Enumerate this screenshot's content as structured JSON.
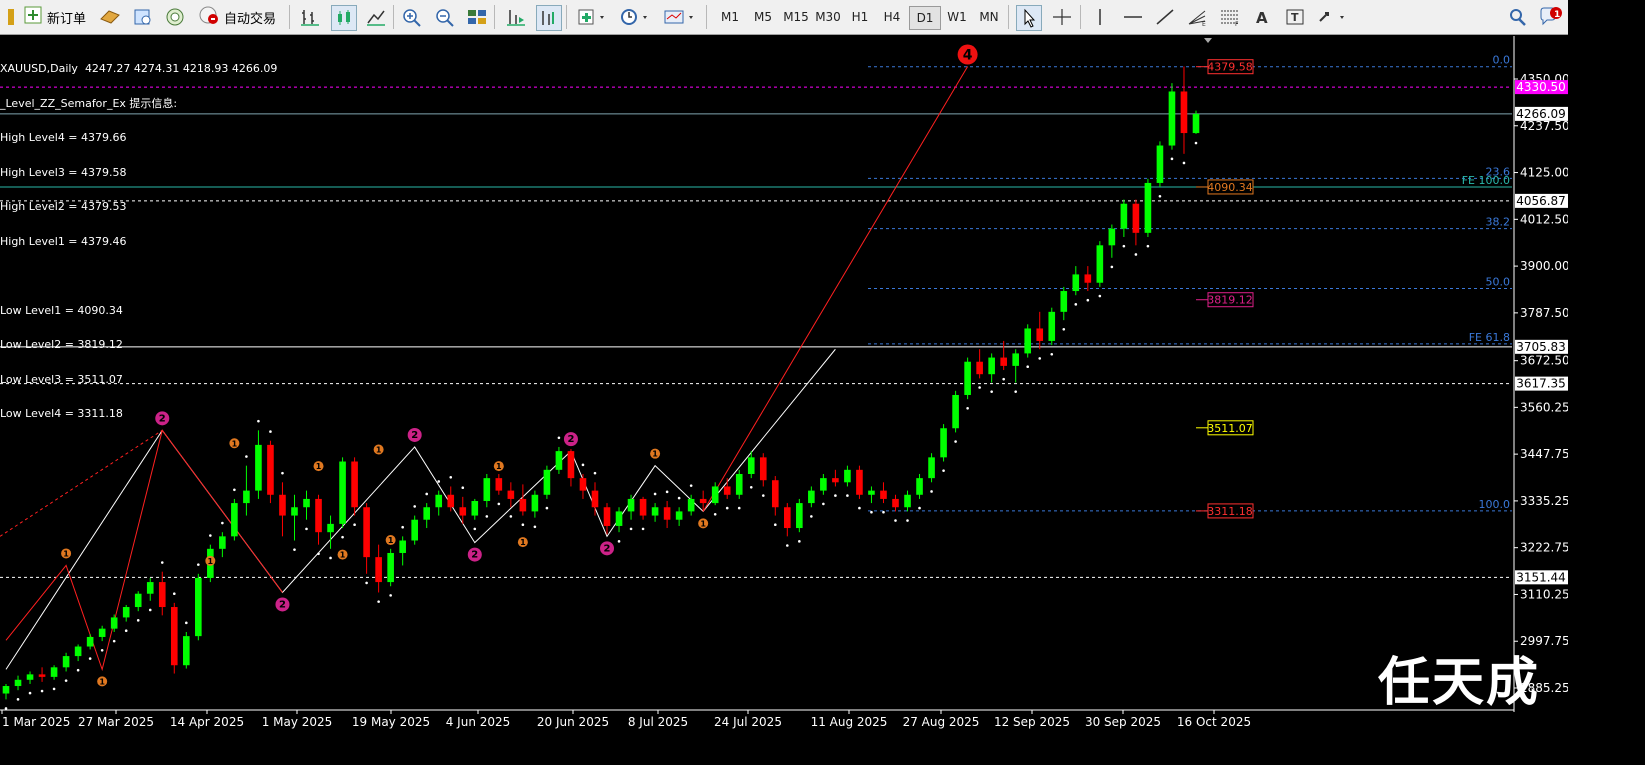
{
  "toolbar": {
    "new_order": "新订单",
    "auto_trade": "自动交易",
    "timeframes": [
      "M1",
      "M5",
      "M15",
      "M30",
      "H1",
      "H4",
      "D1",
      "W1",
      "MN"
    ],
    "active_timeframe": "D1",
    "accent": "#d00000"
  },
  "info": {
    "line1": "XAUUSD,Daily  4247.27 4274.31 4218.93 4266.09",
    "line2": "_Level_ZZ_Semafor_Ex 提示信息:",
    "high4": "High Level4 = 4379.66",
    "high3": "High Level3 = 4379.58",
    "high2": "High Level2 = 4379.53",
    "high1": "High Level1 = 4379.46",
    "low1": "Low Level1 = 4090.34",
    "low2": "Low Level2 = 3819.12",
    "low3": "Low Level3 = 3511.07",
    "low4": "Low Level4 = 3311.18"
  },
  "watermark": "任天成",
  "chart_data": {
    "type": "candlestick",
    "symbol": "XAUUSD",
    "timeframe": "Daily",
    "ohlc_last": {
      "open": 4247.27,
      "high": 4274.31,
      "low": 4218.93,
      "close": 4266.09
    },
    "y_ticks": [
      4350.0,
      4237.5,
      4125.0,
      4012.5,
      3900.0,
      3787.5,
      3672.5,
      3560.25,
      3447.75,
      3335.25,
      3222.75,
      3110.25,
      2997.75,
      2885.25
    ],
    "x_ticks": [
      "1 Mar 2025",
      "27 Mar 2025",
      "14 Apr 2025",
      "1 May 2025",
      "19 May 2025",
      "4 Jun 2025",
      "20 Jun 2025",
      "8 Jul 2025",
      "24 Jul 2025",
      "11 Aug 2025",
      "27 Aug 2025",
      "12 Sep 2025",
      "30 Sep 2025",
      "16 Oct 2025"
    ],
    "price_labels": [
      {
        "text": "4330.50",
        "value": 4330.5,
        "color": "#ff00ff",
        "style": "filled"
      },
      {
        "text": "4266.09",
        "value": 4266.09,
        "color": "#ffffff",
        "style": "filled-light"
      },
      {
        "text": "4056.87",
        "value": 4056.87,
        "color": "#ffffff",
        "style": "filled-light"
      },
      {
        "text": "3705.83",
        "value": 3705.83,
        "color": "#ffffff",
        "style": "filled-light"
      },
      {
        "text": "3617.35",
        "value": 3617.35,
        "color": "#ffffff",
        "style": "filled-light"
      },
      {
        "text": "3151.44",
        "value": 3151.44,
        "color": "#ffffff",
        "style": "filled-light"
      }
    ],
    "level_boxes": [
      {
        "text": "4379.58",
        "value": 4379.58,
        "color": "#ff3030"
      },
      {
        "text": "4090.34",
        "value": 4090.34,
        "color": "#e07820"
      },
      {
        "text": "3819.12",
        "value": 3819.12,
        "color": "#e0208a"
      },
      {
        "text": "3511.07",
        "value": 3511.07,
        "color": "#ffff00"
      },
      {
        "text": "3311.18",
        "value": 3311.18,
        "color": "#ff3030"
      }
    ],
    "fib_levels": [
      {
        "label": "0.0",
        "value": 4379.58
      },
      {
        "label": "23.6",
        "value": 4111.0
      },
      {
        "label": "38.2",
        "value": 3990.0
      },
      {
        "label": "50.0",
        "value": 3846.0
      },
      {
        "label": "FE 61.8",
        "value": 3713.0
      },
      {
        "label": "100.0",
        "value": 3311.18
      }
    ],
    "fe_label": "FE 100.0",
    "horizontal_lines": [
      {
        "value": 4330.5,
        "color": "#ff00ff",
        "dash": "dash"
      },
      {
        "value": 4266.09,
        "color": "#7fa5b0",
        "dash": "solid"
      },
      {
        "value": 4090.34,
        "color": "#2ab7a9",
        "dash": "solid"
      },
      {
        "value": 4056.87,
        "color": "#ffffff",
        "dash": "dash"
      },
      {
        "value": 3705.83,
        "color": "#ffffff",
        "dash": "solid"
      },
      {
        "value": 3617.35,
        "color": "#ffffff",
        "dash": "dash"
      },
      {
        "value": 3151.44,
        "color": "#ffffff",
        "dash": "dash"
      }
    ],
    "semafor_marks": [
      {
        "idx": 5,
        "value": 3180,
        "n": "1",
        "pos": "above"
      },
      {
        "idx": 8,
        "value": 2930,
        "n": "1",
        "pos": "below"
      },
      {
        "idx": 13,
        "value": 3505,
        "n": "2",
        "pos": "above"
      },
      {
        "idx": 17,
        "value": 3220,
        "n": "1",
        "pos": "below"
      },
      {
        "idx": 19,
        "value": 3445,
        "n": "1",
        "pos": "above"
      },
      {
        "idx": 23,
        "value": 3115,
        "n": "2",
        "pos": "below"
      },
      {
        "idx": 26,
        "value": 3390,
        "n": "1",
        "pos": "above"
      },
      {
        "idx": 28,
        "value": 3235,
        "n": "1",
        "pos": "below"
      },
      {
        "idx": 31,
        "value": 3430,
        "n": "1",
        "pos": "above"
      },
      {
        "idx": 32,
        "value": 3270,
        "n": "1",
        "pos": "below"
      },
      {
        "idx": 34,
        "value": 3465,
        "n": "2",
        "pos": "above"
      },
      {
        "idx": 39,
        "value": 3235,
        "n": "2",
        "pos": "below"
      },
      {
        "idx": 41,
        "value": 3390,
        "n": "1",
        "pos": "above"
      },
      {
        "idx": 43,
        "value": 3265,
        "n": "1",
        "pos": "below"
      },
      {
        "idx": 47,
        "value": 3455,
        "n": "2",
        "pos": "above"
      },
      {
        "idx": 50,
        "value": 3250,
        "n": "2",
        "pos": "below"
      },
      {
        "idx": 54,
        "value": 3420,
        "n": "1",
        "pos": "above"
      },
      {
        "idx": 58,
        "value": 3310,
        "n": "1",
        "pos": "below"
      },
      {
        "idx": 80,
        "value": 4380,
        "n": "4",
        "pos": "above"
      }
    ],
    "candles": [
      [
        2872,
        2895,
        2858,
        2890
      ],
      [
        2890,
        2915,
        2880,
        2905
      ],
      [
        2905,
        2925,
        2895,
        2918
      ],
      [
        2918,
        2935,
        2900,
        2912
      ],
      [
        2912,
        2940,
        2905,
        2935
      ],
      [
        2935,
        2970,
        2925,
        2962
      ],
      [
        2962,
        2990,
        2950,
        2985
      ],
      [
        2985,
        3015,
        2978,
        3008
      ],
      [
        3008,
        3035,
        2998,
        3028
      ],
      [
        3028,
        3062,
        3020,
        3055
      ],
      [
        3055,
        3085,
        3045,
        3080
      ],
      [
        3080,
        3118,
        3070,
        3112
      ],
      [
        3112,
        3150,
        3095,
        3140
      ],
      [
        3140,
        3165,
        3060,
        3080
      ],
      [
        3080,
        3090,
        2920,
        2940
      ],
      [
        2940,
        3020,
        2932,
        3010
      ],
      [
        3010,
        3160,
        3000,
        3150
      ],
      [
        3150,
        3230,
        3140,
        3220
      ],
      [
        3220,
        3260,
        3200,
        3250
      ],
      [
        3250,
        3340,
        3240,
        3330
      ],
      [
        3330,
        3420,
        3300,
        3360
      ],
      [
        3360,
        3505,
        3340,
        3470
      ],
      [
        3470,
        3480,
        3330,
        3350
      ],
      [
        3350,
        3380,
        3250,
        3300
      ],
      [
        3300,
        3350,
        3240,
        3320
      ],
      [
        3320,
        3360,
        3290,
        3340
      ],
      [
        3340,
        3350,
        3230,
        3260
      ],
      [
        3260,
        3300,
        3220,
        3280
      ],
      [
        3280,
        3440,
        3270,
        3430
      ],
      [
        3430,
        3440,
        3300,
        3320
      ],
      [
        3320,
        3330,
        3160,
        3200
      ],
      [
        3200,
        3230,
        3115,
        3140
      ],
      [
        3140,
        3220,
        3130,
        3210
      ],
      [
        3210,
        3250,
        3180,
        3240
      ],
      [
        3240,
        3300,
        3230,
        3290
      ],
      [
        3290,
        3330,
        3270,
        3320
      ],
      [
        3320,
        3360,
        3300,
        3350
      ],
      [
        3350,
        3370,
        3310,
        3320
      ],
      [
        3320,
        3345,
        3280,
        3300
      ],
      [
        3300,
        3340,
        3290,
        3335
      ],
      [
        3335,
        3400,
        3320,
        3390
      ],
      [
        3390,
        3400,
        3350,
        3360
      ],
      [
        3360,
        3380,
        3320,
        3340
      ],
      [
        3340,
        3375,
        3300,
        3310
      ],
      [
        3310,
        3360,
        3295,
        3350
      ],
      [
        3350,
        3420,
        3340,
        3410
      ],
      [
        3410,
        3465,
        3400,
        3455
      ],
      [
        3455,
        3460,
        3370,
        3390
      ],
      [
        3390,
        3400,
        3340,
        3360
      ],
      [
        3360,
        3380,
        3300,
        3320
      ],
      [
        3320,
        3330,
        3255,
        3275
      ],
      [
        3275,
        3320,
        3260,
        3310
      ],
      [
        3310,
        3350,
        3290,
        3340
      ],
      [
        3340,
        3345,
        3290,
        3300
      ],
      [
        3300,
        3330,
        3285,
        3320
      ],
      [
        3320,
        3335,
        3270,
        3290
      ],
      [
        3290,
        3320,
        3275,
        3310
      ],
      [
        3310,
        3350,
        3300,
        3340
      ],
      [
        3340,
        3360,
        3310,
        3330
      ],
      [
        3330,
        3380,
        3325,
        3370
      ],
      [
        3370,
        3390,
        3340,
        3350
      ],
      [
        3350,
        3410,
        3340,
        3400
      ],
      [
        3400,
        3455,
        3390,
        3440
      ],
      [
        3440,
        3450,
        3370,
        3385
      ],
      [
        3385,
        3395,
        3300,
        3320
      ],
      [
        3320,
        3330,
        3250,
        3270
      ],
      [
        3270,
        3340,
        3260,
        3330
      ],
      [
        3330,
        3370,
        3320,
        3360
      ],
      [
        3360,
        3400,
        3350,
        3390
      ],
      [
        3390,
        3410,
        3370,
        3380
      ],
      [
        3380,
        3420,
        3370,
        3410
      ],
      [
        3410,
        3420,
        3340,
        3350
      ],
      [
        3350,
        3370,
        3330,
        3360
      ],
      [
        3360,
        3380,
        3330,
        3340
      ],
      [
        3340,
        3350,
        3310,
        3320
      ],
      [
        3320,
        3360,
        3310,
        3350
      ],
      [
        3350,
        3400,
        3340,
        3390
      ],
      [
        3390,
        3450,
        3380,
        3440
      ],
      [
        3440,
        3520,
        3430,
        3510
      ],
      [
        3510,
        3600,
        3500,
        3590
      ],
      [
        3590,
        3680,
        3580,
        3670
      ],
      [
        3670,
        3700,
        3630,
        3640
      ],
      [
        3640,
        3690,
        3620,
        3680
      ],
      [
        3680,
        3720,
        3650,
        3660
      ],
      [
        3660,
        3700,
        3620,
        3690
      ],
      [
        3690,
        3760,
        3680,
        3750
      ],
      [
        3750,
        3790,
        3700,
        3720
      ],
      [
        3720,
        3800,
        3710,
        3790
      ],
      [
        3790,
        3850,
        3770,
        3840
      ],
      [
        3840,
        3900,
        3830,
        3880
      ],
      [
        3880,
        3900,
        3840,
        3860
      ],
      [
        3860,
        3960,
        3850,
        3950
      ],
      [
        3950,
        4000,
        3920,
        3990
      ],
      [
        3990,
        4060,
        3970,
        4050
      ],
      [
        4050,
        4060,
        3950,
        3980
      ],
      [
        3980,
        4110,
        3970,
        4100
      ],
      [
        4100,
        4200,
        4090,
        4190
      ],
      [
        4190,
        4340,
        4180,
        4320
      ],
      [
        4320,
        4380,
        4170,
        4220
      ],
      [
        4220,
        4274,
        4218,
        4266
      ]
    ],
    "ylim": [
      2850,
      4410
    ],
    "grid": false
  }
}
